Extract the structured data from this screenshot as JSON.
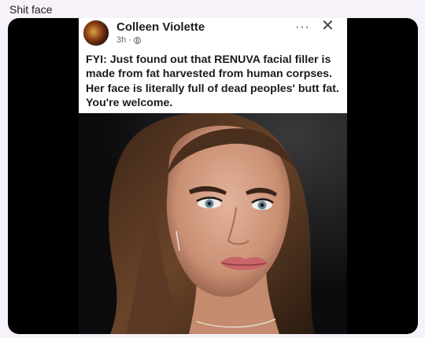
{
  "caption": "Shit face",
  "post": {
    "author": "Colleen Violette",
    "time": "3h",
    "visibility_icon": "globe-icon",
    "more_label": "···",
    "close_label": "✕",
    "text": "FYI: Just found out that RENUVA facial filler is made from fat harvested from human corpses. Her face is literally full of dead peoples' butt fat. You're welcome."
  },
  "photo": {
    "subject": "woman-portrait",
    "hair_color": "#5a3a24",
    "skin_color": "#d9a48c",
    "lip_color": "#c9646a"
  }
}
